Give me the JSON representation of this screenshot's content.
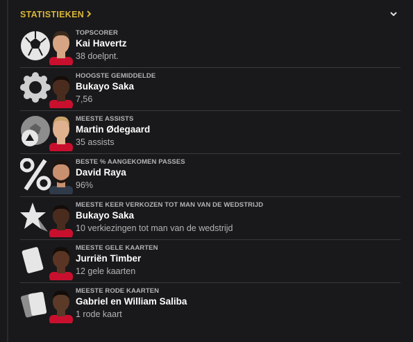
{
  "header": {
    "title": "STATISTIEKEN",
    "chevron": "chevron-right-icon",
    "collapse_icon": "chevron-down-icon",
    "accent": "#d9b63a"
  },
  "rows": [
    {
      "category": "TOPSCORER",
      "player": "Kai Havertz",
      "value": "38 doelpnt.",
      "icon": "football-icon",
      "skin": "#d7a583",
      "hair": "#3b2a1d"
    },
    {
      "category": "HOOGSTE GEMIDDELDE",
      "player": "Bukayo Saka",
      "value": "7,56",
      "icon": "rosette-badge-icon",
      "skin": "#4a2c1e",
      "hair": "#140c08"
    },
    {
      "category": "MEESTE ASSISTS",
      "player": "Martin Ødegaard",
      "value": "35 assists",
      "icon": "assist-football-icon",
      "skin": "#e0b18e",
      "hair": "#c9a26a"
    },
    {
      "category": "BESTE % AANGEKOMEN PASSES",
      "player": "David Raya",
      "value": "96%",
      "icon": "percent-icon",
      "skin": "#c99070",
      "hair": "#1e1510"
    },
    {
      "category": "MEESTE KEER VERKOZEN TOT MAN VAN DE WEDSTRIJD",
      "player": "Bukayo Saka",
      "value": "10 verkiezingen tot man van de wedstrijd",
      "icon": "star-icon",
      "skin": "#4a2c1e",
      "hair": "#140c08"
    },
    {
      "category": "MEESTE GELE KAARTEN",
      "player": "Jurriën Timber",
      "value": "12 gele kaarten",
      "icon": "yellow-card-icon",
      "skin": "#5a3524",
      "hair": "#150d09"
    },
    {
      "category": "MEESTE RODE KAARTEN",
      "player": "Gabriel en William Saliba",
      "value": "1 rode kaart",
      "icon": "red-card-icon",
      "skin": "#5b3a28",
      "hair": "#120c09"
    }
  ]
}
